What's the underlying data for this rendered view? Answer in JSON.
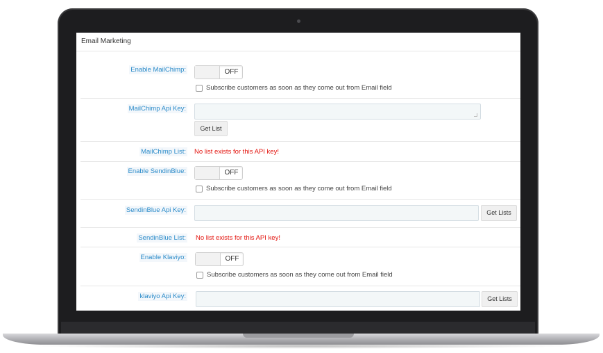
{
  "panel": {
    "title": "Email Marketing"
  },
  "mailchimp": {
    "enable_label": "Enable MailChimp:",
    "toggle_text": "OFF",
    "subscribe_text": "Subscribe customers as soon as they come out from Email field",
    "api_key_label": "MailChimp Api Key:",
    "api_key_value": "",
    "get_list_button": "Get List",
    "list_label": "MailChimp List:",
    "list_error": "No list exists for this API key!"
  },
  "sendinblue": {
    "enable_label": "Enable SendinBlue:",
    "toggle_text": "OFF",
    "subscribe_text": "Subscribe customers as soon as they come out from Email field",
    "api_key_label": "SendinBlue Api Key:",
    "api_key_value": "",
    "get_lists_button": "Get Lists",
    "list_label": "SendinBlue List:",
    "list_error": "No list exists for this API key!"
  },
  "klaviyo": {
    "enable_label": "Enable Klaviyo:",
    "toggle_text": "OFF",
    "subscribe_text": "Subscribe customers as soon as they come out from Email field",
    "api_key_label": "klaviyo Api Key:",
    "api_key_value": "",
    "get_lists_button": "Get Lists"
  },
  "colors": {
    "label": "#2b8bc9",
    "error": "#e3140e",
    "input_bg": "#f3f7f8"
  }
}
